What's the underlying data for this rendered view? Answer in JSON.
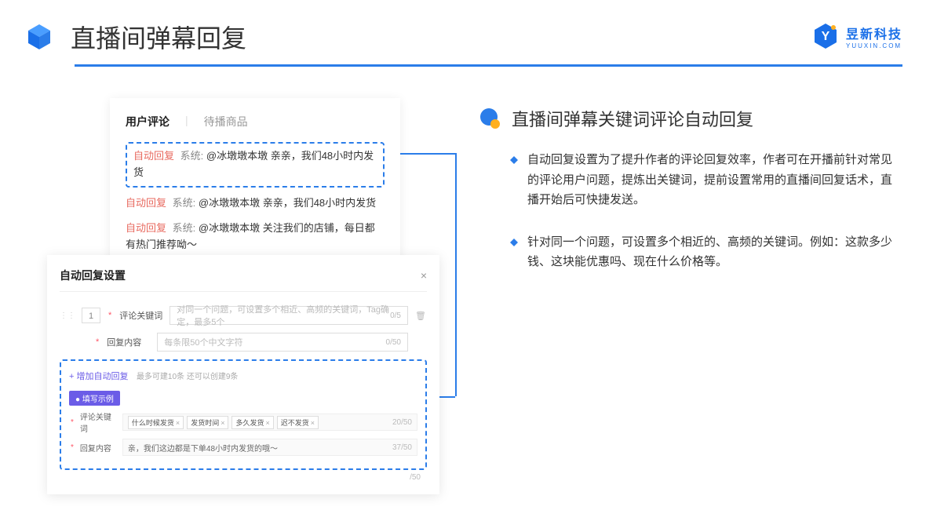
{
  "header": {
    "title": "直播间弹幕回复"
  },
  "logo": {
    "cn": "昱新科技",
    "en": "YUUXIN.COM"
  },
  "comments": {
    "tab1": "用户评论",
    "tab2": "待播商品",
    "auto": "自动回复",
    "sys": "系统:",
    "c1": "@冰墩墩本墩 亲亲，我们48小时内发货",
    "c2": "@冰墩墩本墩 亲亲，我们48小时内发货",
    "c3": "@冰墩墩本墩 关注我们的店铺，每日都有热门推荐呦～"
  },
  "settings": {
    "title": "自动回复设置",
    "rownum": "1",
    "kw_label": "评论关键词",
    "kw_ph": "对同一个问题，可设置多个相近、高频的关键词，Tag确定，最多5个",
    "kw_count": "0/5",
    "content_label": "回复内容",
    "content_ph": "每条限50个中文字符",
    "content_count": "0/50",
    "add": "+ 增加自动回复",
    "add_hint": "最多可建10条 还可以创建9条",
    "example": "● 填写示例",
    "ex_kw_label": "评论关键词",
    "ex_tags": [
      "什么时候发货",
      "发货时间",
      "多久发货",
      "迟不发货"
    ],
    "ex_kw_count": "20/50",
    "ex_content_label": "回复内容",
    "ex_content": "亲，我们这边都是下单48小时内发货的哦～",
    "ex_content_count": "37/50",
    "trailing_count": "/50"
  },
  "right": {
    "title": "直播间弹幕关键词评论自动回复",
    "b1": "自动回复设置为了提升作者的评论回复效率，作者可在开播前针对常见的评论用户问题，提炼出关键词，提前设置常用的直播间回复话术，直播开始后可快捷发送。",
    "b2": "针对同一个问题，可设置多个相近的、高频的关键词。例如：这款多少钱、这块能优惠吗、现在什么价格等。"
  }
}
